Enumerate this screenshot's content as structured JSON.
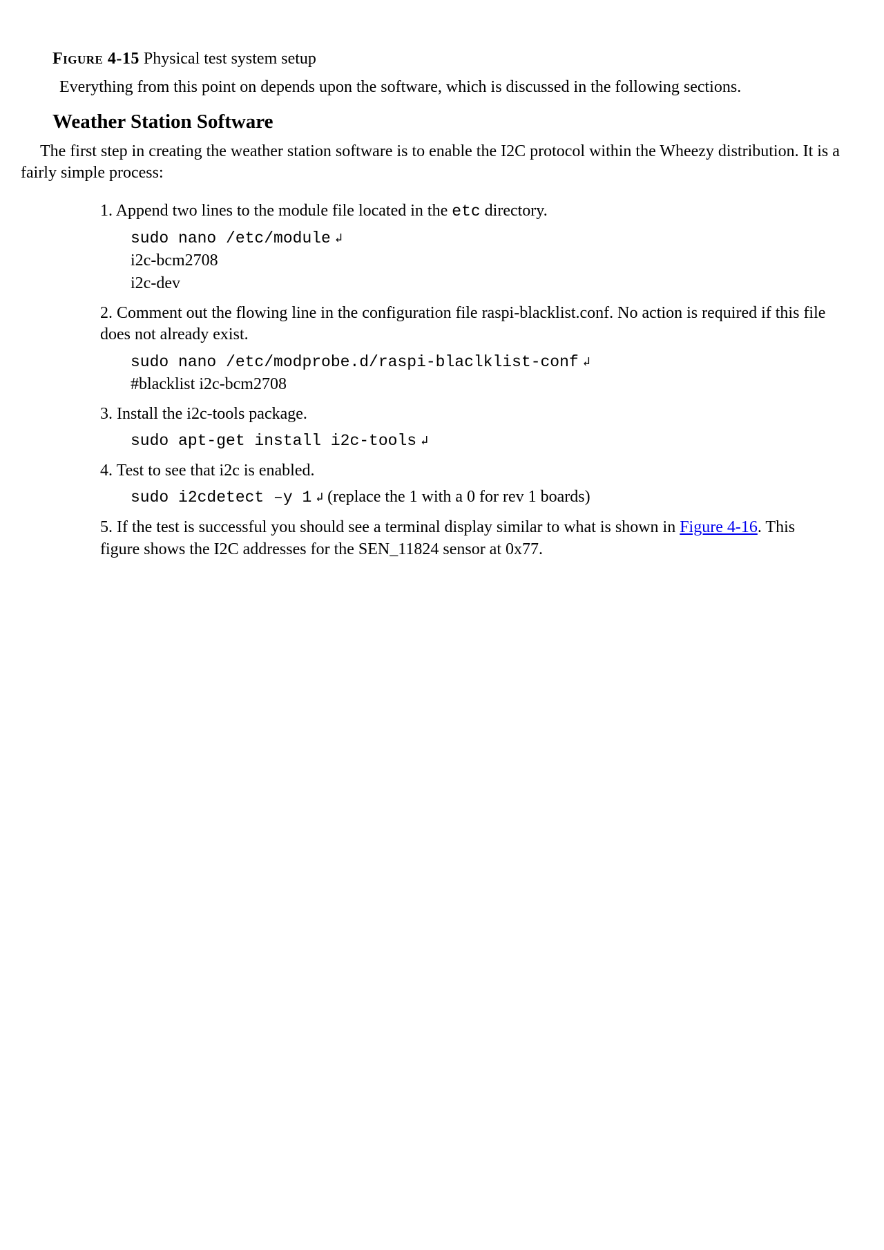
{
  "figure": {
    "label": "Figure",
    "number": "4-15",
    "caption": "Physical test system setup"
  },
  "intro_paragraph": "Everything from this point on depends upon the software, which is discussed in the following sections.",
  "section_heading": "Weather Station Software",
  "section_intro": "The first step in creating the weather station software is to enable the I2C protocol within the Wheezy distribution. It is a fairly simple process:",
  "steps": {
    "s1": {
      "num": "1.",
      "text_before_code": "Append two lines to the module file located in the ",
      "inline_code": "etc",
      "text_after_code": " directory.",
      "code_line1": "sudo nano /etc/module",
      "enter": "↲",
      "code_line2": "i2c-bcm2708",
      "code_line3": "i2c-dev"
    },
    "s2": {
      "num": "2.",
      "text": "Comment out the flowing line in the configuration file raspi-blacklist.conf. No action is required if this file does not already exist.",
      "code_line1": "sudo nano /etc/modprobe.d/raspi-blaclklist-conf",
      "enter": "↲",
      "code_line2": "#blacklist i2c-bcm2708"
    },
    "s3": {
      "num": "3.",
      "text": "Install the i2c-tools package.",
      "code_line1": "sudo apt-get install i2c-tools",
      "enter": "↲"
    },
    "s4": {
      "num": "4.",
      "text": "Test to see that i2c is enabled.",
      "code_line1": "sudo i2cdetect –y 1",
      "enter": "↲",
      "parenthetical": "(replace the 1 with a 0 for rev 1 boards)"
    },
    "s5": {
      "num": "5.",
      "text_before_link": "If the test is successful you should see a terminal display similar to what is shown in ",
      "link_text": "Figure 4-16",
      "text_after_link": ". This figure shows the I2C addresses for the SEN_11824 sensor at 0x77."
    }
  }
}
